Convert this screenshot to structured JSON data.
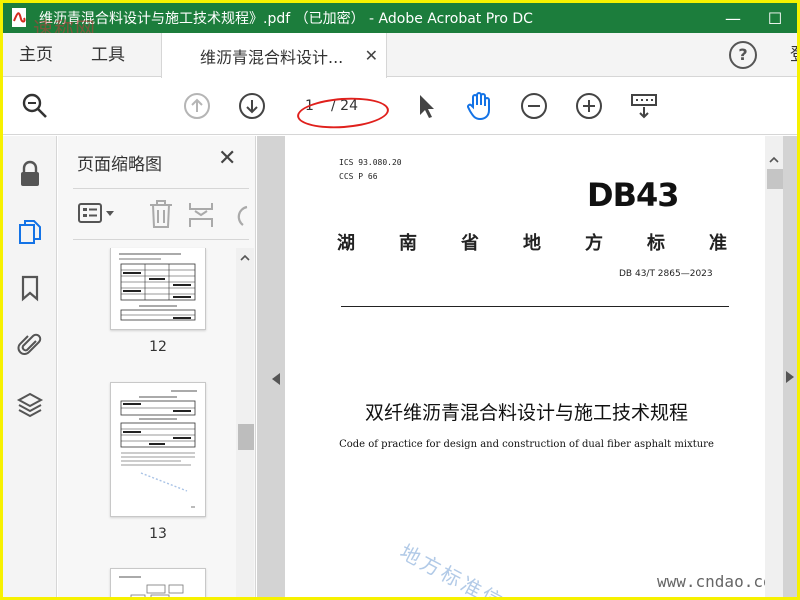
{
  "window": {
    "title": "维沥青混合料设计与施工技术规程》.pdf （已加密） - Adobe Acrobat Pro DC",
    "minimize_glyph": "—",
    "maximize_glyph": "☐",
    "title_bar_color": "#1c7d3c",
    "border_color": "#f7f100"
  },
  "overlay_watermark_top_left": "速称网",
  "menu": {
    "home": "主页",
    "tools": "工具",
    "tab_label": "维沥青混合料设计...",
    "tab_close": "✕",
    "help": "?",
    "cut_text": "登"
  },
  "toolbar": {
    "current_page": "1",
    "total_pages": "/ 24",
    "icons": [
      "zoom-icon",
      "page-up-icon",
      "page-down-icon",
      "select-arrow-icon",
      "hand-tool-icon",
      "zoom-out-icon",
      "zoom-in-icon",
      "keyboard-marquee-icon"
    ],
    "annotation_color": "#e0201c",
    "accent_color": "#1473e6"
  },
  "left_rail": {
    "icons": [
      "lock-icon",
      "page-thumbnails-icon",
      "bookmark-icon",
      "attachment-icon",
      "layers-icon"
    ]
  },
  "thumbnails_panel": {
    "title": "页面缩略图",
    "close": "✕",
    "tools": [
      "thumbnail-options-icon",
      "delete-page-icon",
      "insert-page-icon",
      "rotate-page-icon"
    ],
    "pages": [
      {
        "number": "12"
      },
      {
        "number": "13"
      }
    ]
  },
  "document": {
    "ics": "ICS  93.080.20",
    "ccs": "CCS  P 66",
    "logo": "DB43",
    "province_chars": [
      "湖",
      "南",
      "省",
      "地",
      "方",
      "标",
      "准"
    ],
    "standard_number": "DB 43/T  2865—2023",
    "title_cn": "双纤维沥青混合料设计与施工技术规程",
    "title_en": "Code of practice for design and construction of dual fiber asphalt mixture",
    "watermark_diag": "地方标准信",
    "watermark_corner": "www.cndao.com"
  }
}
